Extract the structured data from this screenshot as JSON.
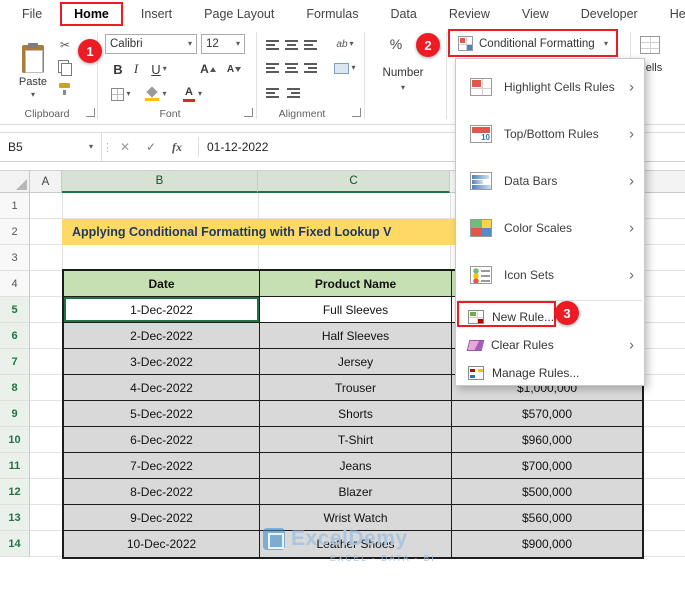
{
  "colors": {
    "accent_red": "#ed1c24",
    "banner_bg": "#ffd966",
    "banner_text": "#1f3864",
    "header_green": "#c6e0b4",
    "row_gray": "#d9d9d9",
    "excel_green": "#217346"
  },
  "tabs": [
    "File",
    "Home",
    "Insert",
    "Page Layout",
    "Formulas",
    "Data",
    "Review",
    "View",
    "Developer",
    "Help"
  ],
  "ribbon": {
    "paste": "Paste",
    "clipboard_group": "Clipboard",
    "font_name": "Calibri",
    "font_size": "12",
    "bold": "B",
    "italic": "I",
    "underline": "U",
    "letter_A": "A",
    "wrap": "ab",
    "percent": "%",
    "font_group": "Font",
    "alignment_group": "Alignment",
    "number_button": "Number",
    "conditional_formatting": "Conditional Formatting",
    "cells": "Cells"
  },
  "callouts": [
    "1",
    "2",
    "3"
  ],
  "formula_bar": {
    "name_box": "B5",
    "fx": "fx",
    "value": "01-12-2022"
  },
  "menu": {
    "items": [
      {
        "label": "Highlight Cells Rules"
      },
      {
        "label": "Top/Bottom Rules"
      },
      {
        "label": "Data Bars"
      },
      {
        "label": "Color Scales"
      },
      {
        "label": "Icon Sets"
      }
    ],
    "new_rule": "New Rule...",
    "clear_rules": "Clear Rules",
    "manage_rules": "Manage Rules..."
  },
  "sheet": {
    "col_headers": [
      "A",
      "B",
      "C"
    ],
    "row_numbers": [
      "1",
      "2",
      "3",
      "4",
      "5",
      "6",
      "7",
      "8",
      "9",
      "10",
      "11",
      "12",
      "13",
      "14"
    ],
    "banner": "Applying Conditional Formatting with Fixed Lookup V",
    "table_headers": [
      "Date",
      "Product Name"
    ],
    "rows": [
      {
        "date": "1-Dec-2022",
        "product": "Full Sleeves",
        "amount": ""
      },
      {
        "date": "2-Dec-2022",
        "product": "Half Sleeves",
        "amount": ""
      },
      {
        "date": "3-Dec-2022",
        "product": "Jersey",
        "amount": ""
      },
      {
        "date": "4-Dec-2022",
        "product": "Trouser",
        "amount": "$1,000,000"
      },
      {
        "date": "5-Dec-2022",
        "product": "Shorts",
        "amount": "$570,000"
      },
      {
        "date": "6-Dec-2022",
        "product": "T-Shirt",
        "amount": "$960,000"
      },
      {
        "date": "7-Dec-2022",
        "product": "Jeans",
        "amount": "$700,000"
      },
      {
        "date": "8-Dec-2022",
        "product": "Blazer",
        "amount": "$500,000"
      },
      {
        "date": "9-Dec-2022",
        "product": "Wrist Watch",
        "amount": "$560,000"
      },
      {
        "date": "10-Dec-2022",
        "product": "Leather Shoes",
        "amount": "$900,000"
      }
    ]
  },
  "watermark": {
    "name": "ExcelDemy",
    "tagline": "EXCEL - DATA - BI"
  }
}
